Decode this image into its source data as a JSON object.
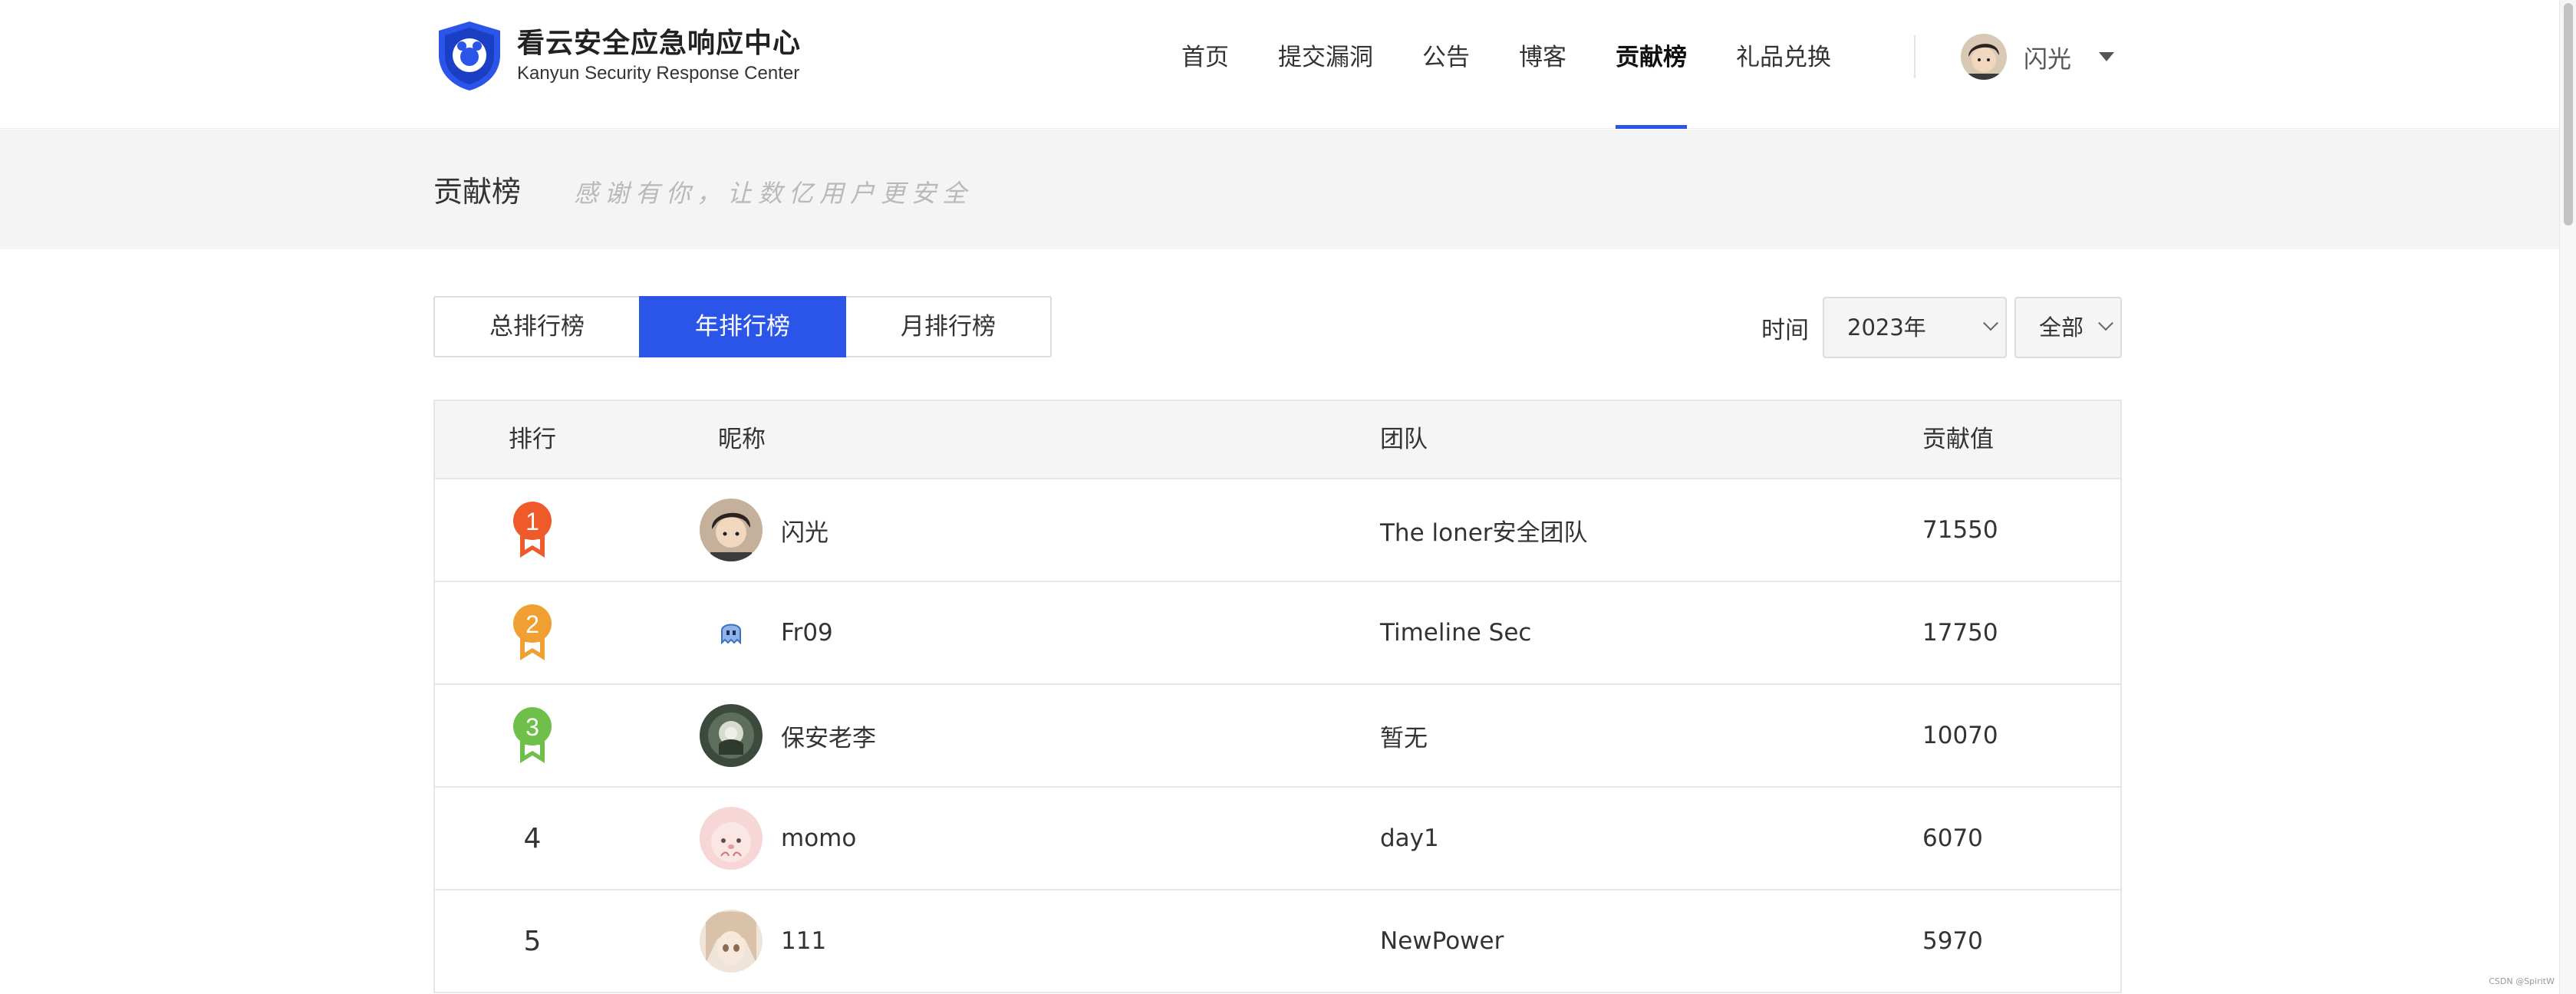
{
  "header": {
    "logo_cn": "看云安全应急响应中心",
    "logo_en": "Kanyun Security Response Center",
    "nav": [
      {
        "label": "首页",
        "active": false
      },
      {
        "label": "提交漏洞",
        "active": false
      },
      {
        "label": "公告",
        "active": false
      },
      {
        "label": "博客",
        "active": false
      },
      {
        "label": "贡献榜",
        "active": true
      },
      {
        "label": "礼品兑换",
        "active": false
      }
    ],
    "user_name": "闪光"
  },
  "banner": {
    "title": "贡献榜",
    "slogan": "感谢有你，让数亿用户更安全"
  },
  "tabs": [
    {
      "label": "总排行榜",
      "active": false
    },
    {
      "label": "年排行榜",
      "active": true
    },
    {
      "label": "月排行榜",
      "active": false
    }
  ],
  "filter": {
    "label": "时间",
    "year": "2023年",
    "scope": "全部"
  },
  "table": {
    "headers": {
      "rank": "排行",
      "nick": "昵称",
      "team": "团队",
      "score": "贡献值"
    },
    "rows": [
      {
        "rank": "1",
        "nick": "闪光",
        "team": "The loner安全团队",
        "score": "71550"
      },
      {
        "rank": "2",
        "nick": "Fr09",
        "team": "Timeline Sec",
        "score": "17750"
      },
      {
        "rank": "3",
        "nick": "保安老李",
        "team": "暂无",
        "score": "10070"
      },
      {
        "rank": "4",
        "nick": "momo",
        "team": "day1",
        "score": "6070"
      },
      {
        "rank": "5",
        "nick": "111",
        "team": "NewPower",
        "score": "5970"
      }
    ]
  },
  "colors": {
    "accent": "#2b55e8",
    "medal_gold": "#ef5a2a",
    "medal_silver": "#f0a033",
    "medal_bronze": "#6fc04a"
  },
  "watermark": "CSDN @SpiritW"
}
